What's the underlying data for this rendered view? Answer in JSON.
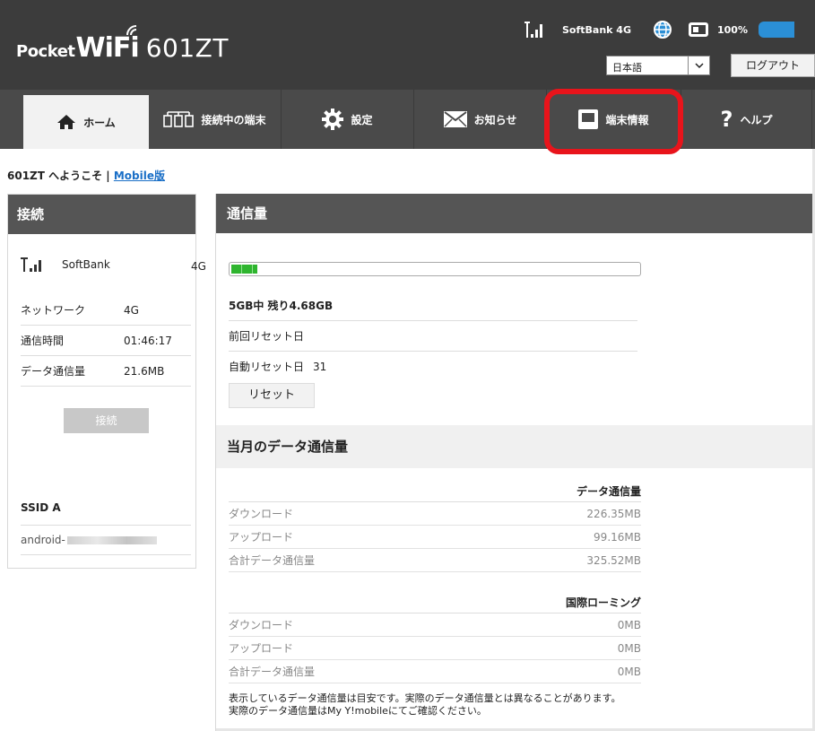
{
  "header": {
    "logo_pocket": "Pocket",
    "logo_wifi": "WiFi",
    "logo_model": "601ZT",
    "carrier": "SoftBank  4G",
    "battery_pct": "100%",
    "language": "日本語",
    "logout": "ログアウト"
  },
  "nav": {
    "tabs": [
      {
        "label": "ホーム",
        "icon": "home-icon"
      },
      {
        "label": "接続中の端末",
        "icon": "devices-icon"
      },
      {
        "label": "設定",
        "icon": "gear-icon"
      },
      {
        "label": "お知らせ",
        "icon": "mail-icon"
      },
      {
        "label": "端末情報",
        "icon": "device-info-icon"
      },
      {
        "label": "ヘルプ",
        "icon": "help-icon"
      }
    ]
  },
  "welcome": {
    "text": "601ZT へようこそ | ",
    "mobile_link": "Mobile版"
  },
  "connection": {
    "title": "接続",
    "carrier": "SoftBank",
    "net": "4G",
    "rows": [
      {
        "k": "ネットワーク",
        "v": "4G"
      },
      {
        "k": "通信時間",
        "v": "01:46:17"
      },
      {
        "k": "データ通信量",
        "v": "21.6MB"
      }
    ],
    "connect_button": "接続",
    "ssid_title": "SSID A",
    "ssid_prefix": "android-"
  },
  "usage": {
    "title": "通信量",
    "used_fraction": 0.064,
    "remaining": "5GB中  残り4.68GB",
    "last_reset_label": "前回リセット日",
    "auto_reset_label": "自動リセット日",
    "auto_reset_value": "31",
    "reset_button": "リセット"
  },
  "monthly": {
    "title": "当月のデータ通信量",
    "data_header": "データ通信量",
    "data_rows": [
      {
        "k": "ダウンロード",
        "v": "226.35MB"
      },
      {
        "k": "アップロード",
        "v": "99.16MB"
      },
      {
        "k": "合計データ通信量",
        "v": "325.52MB"
      }
    ],
    "roaming_header": "国際ローミング",
    "roaming_rows": [
      {
        "k": "ダウンロード",
        "v": "0MB"
      },
      {
        "k": "アップロード",
        "v": "0MB"
      },
      {
        "k": "合計データ通信量",
        "v": "0MB"
      }
    ],
    "note_line1": "表示しているデータ通信量は目安です。実際のデータ通信量とは異なることがあります。",
    "note_line2": "実際のデータ通信量はMy Y!mobileにてご確認ください。"
  },
  "colors": {
    "header_bg": "#3c3c3c",
    "nav_bg": "#4a4a4a",
    "highlight": "#e8141b",
    "link": "#1a6fc7",
    "usage_bar": "#2fb52f"
  }
}
